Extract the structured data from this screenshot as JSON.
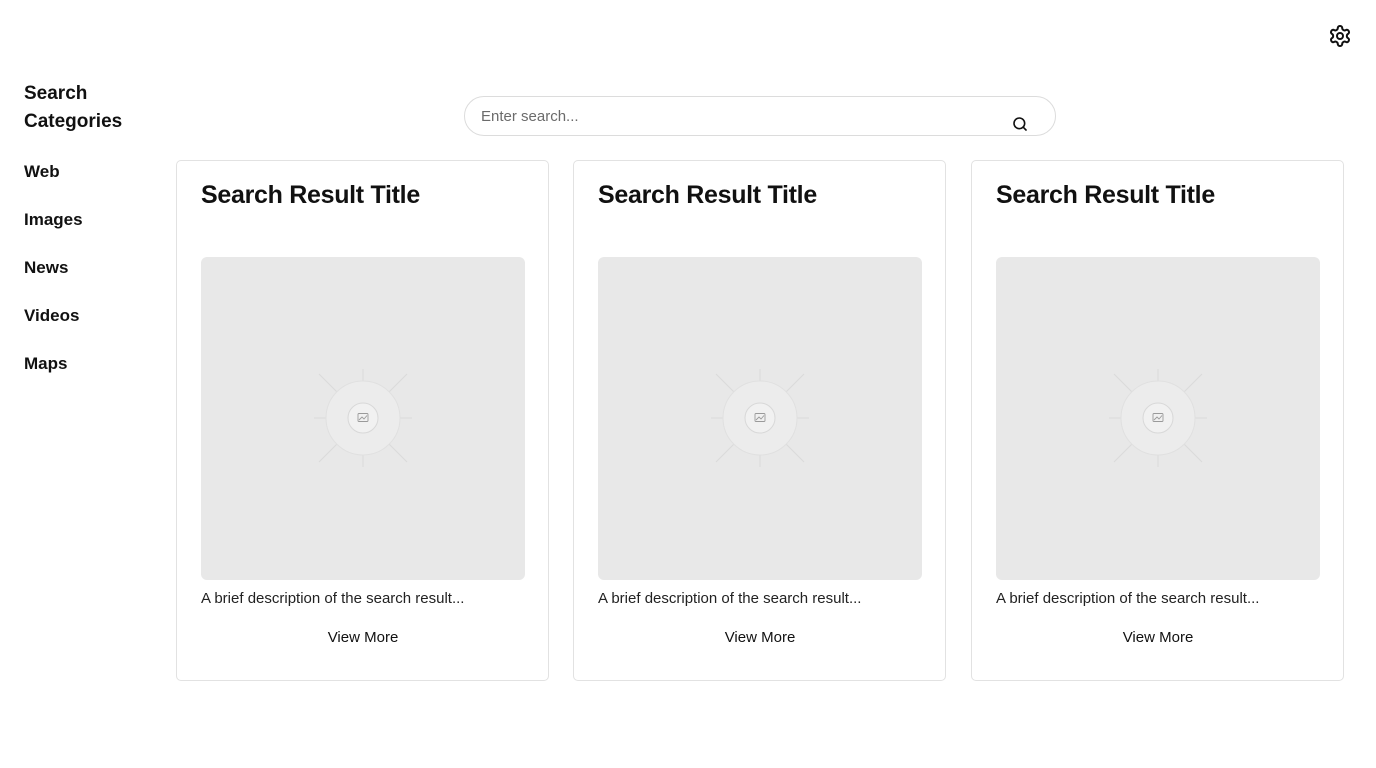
{
  "header": {
    "settings_icon": "gear-icon"
  },
  "sidebar": {
    "title": "Search Categories",
    "items": [
      {
        "label": "Web"
      },
      {
        "label": "Images"
      },
      {
        "label": "News"
      },
      {
        "label": "Videos"
      },
      {
        "label": "Maps"
      }
    ]
  },
  "search": {
    "placeholder": "Enter search...",
    "value": "",
    "icon": "search-icon"
  },
  "results": [
    {
      "title": "Search Result Title",
      "description": "A brief description of the search result...",
      "button_label": "View More",
      "image_icon": "image-placeholder-icon"
    },
    {
      "title": "Search Result Title",
      "description": "A brief description of the search result...",
      "button_label": "View More",
      "image_icon": "image-placeholder-icon"
    },
    {
      "title": "Search Result Title",
      "description": "A brief description of the search result...",
      "button_label": "View More",
      "image_icon": "image-placeholder-icon"
    }
  ],
  "colors": {
    "background": "#ffffff",
    "text": "#111111",
    "border": "#e2e2e2",
    "image_placeholder": "#e8e8e8"
  }
}
